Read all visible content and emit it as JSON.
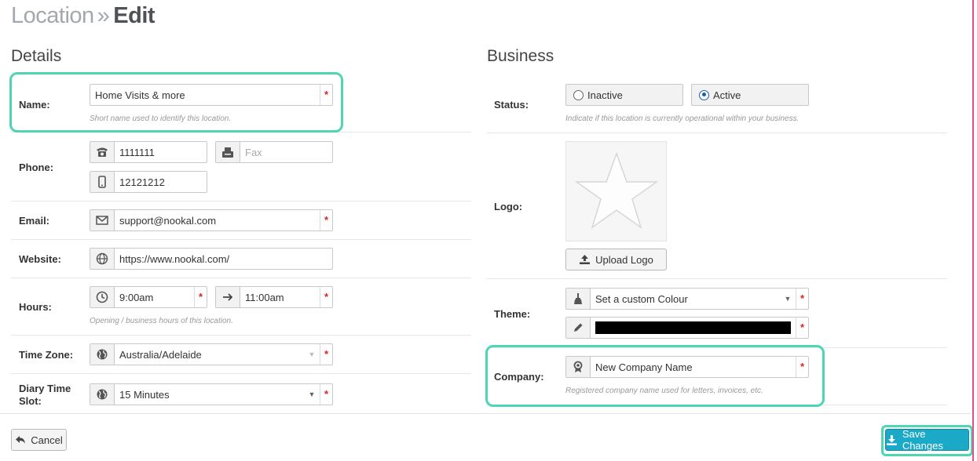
{
  "breadcrumb": {
    "parent": "Location",
    "separator": "»",
    "current": "Edit"
  },
  "details": {
    "title": "Details",
    "name": {
      "label": "Name:",
      "value": "Home Visits & more",
      "help": "Short name used to identify this location."
    },
    "phone": {
      "label": "Phone:",
      "phone_value": "1111111",
      "fax_placeholder": "Fax",
      "mobile_value": "12121212"
    },
    "email": {
      "label": "Email:",
      "value": "support@nookal.com"
    },
    "website": {
      "label": "Website:",
      "value": "https://www.nookal.com/"
    },
    "hours": {
      "label": "Hours:",
      "open": "9:00am",
      "close": "11:00am",
      "help": "Opening / business hours of this location."
    },
    "timezone": {
      "label": "Time Zone:",
      "value": "Australia/Adelaide"
    },
    "diary_slot": {
      "label": "Diary Time Slot:",
      "value": "15 Minutes"
    }
  },
  "business": {
    "title": "Business",
    "status": {
      "label": "Status:",
      "options": [
        "Inactive",
        "Active"
      ],
      "selected": "Active",
      "help": "Indicate if this location is currently operational within your business."
    },
    "logo": {
      "label": "Logo:",
      "upload_label": "Upload Logo"
    },
    "theme": {
      "label": "Theme:",
      "value": "Set a custom Colour",
      "colour_hex": "#000000"
    },
    "company": {
      "label": "Company:",
      "value": "New Company Name",
      "help": "Registered company name used for letters, invoices, etc."
    }
  },
  "footer": {
    "cancel_label": "Cancel",
    "save_label": "Save Changes"
  },
  "colors": {
    "highlight": "#4fd4b4",
    "primary": "#1aa9c6",
    "required": "#dd2222"
  },
  "required_mark": "*"
}
